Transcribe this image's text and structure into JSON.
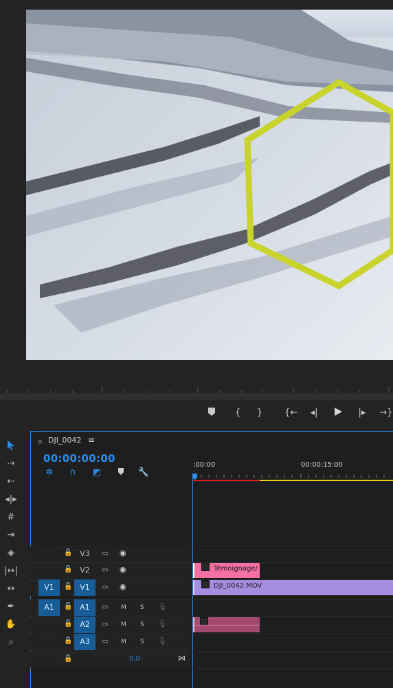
{
  "timeline": {
    "tab_close": "×",
    "tab_title": "DJI_0042",
    "tab_menu": "≡",
    "timecode": "00:00:00:00",
    "ruler_labels": [
      ":00:00",
      "00:00:15:00"
    ]
  },
  "tracks": {
    "video": [
      {
        "label": "V3",
        "source": ""
      },
      {
        "label": "V2",
        "source": ""
      },
      {
        "label": "V1",
        "source": "V1"
      }
    ],
    "audio": [
      {
        "label": "A1",
        "source": "A1",
        "m": "M",
        "s": "S"
      },
      {
        "label": "A2",
        "source": "",
        "m": "M",
        "s": "S"
      },
      {
        "label": "A3",
        "source": "",
        "m": "M",
        "s": "S"
      }
    ],
    "master_value": "0,0"
  },
  "clips": {
    "v2_title": "Témoignage/",
    "v1_title": "DJI_0042.MOV"
  },
  "colors": {
    "accent": "#2d8ceb",
    "hexagon": "#c8d42c",
    "clip_pink": "#f46fa2",
    "clip_violet": "#a78de0",
    "clip_audio": "#a34a6e"
  },
  "icons": {
    "tools": [
      "selection-tool-icon",
      "track-select-forward-icon",
      "track-select-backward-icon",
      "ripple-edit-icon",
      "rolling-edit-icon",
      "rate-stretch-icon",
      "razor-icon",
      "slip-icon",
      "slide-icon",
      "pen-icon",
      "hand-icon",
      "zoom-icon"
    ],
    "transport": [
      "add-marker-icon",
      "mark-in-icon",
      "mark-out-icon",
      "go-to-in-icon",
      "step-back-icon",
      "play-icon",
      "step-forward-icon",
      "go-to-out-icon"
    ]
  }
}
